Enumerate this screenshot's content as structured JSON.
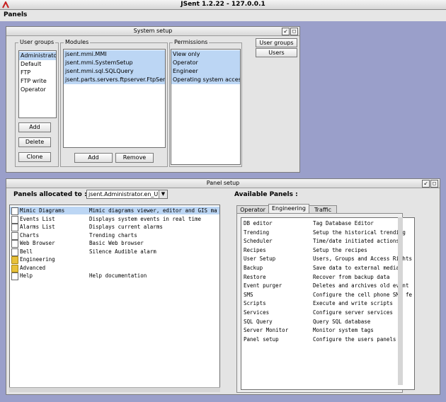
{
  "app_title": "JSent 1.2.22 - 127.0.0.1",
  "menu": {
    "panels": "Panels"
  },
  "system_setup": {
    "title": "System setup",
    "user_groups_label": "User groups",
    "user_groups": [
      "Administrator",
      "Default",
      "FTP",
      "FTP write",
      "Operator"
    ],
    "modules_label": "Modules",
    "modules": [
      "jsent.mmi.MMI",
      "jsent.mmi.SystemSetup",
      "jsent.mmi.sql.SQLQuery",
      "jsent.parts.servers.ftpserver.FtpServer"
    ],
    "permissions_label": "Permissions",
    "permissions": [
      "View only",
      "Operator",
      "Engineer",
      "Operating system access"
    ],
    "btn_add": "Add",
    "btn_delete": "Delete",
    "btn_clone": "Clone",
    "btn_module_add": "Add",
    "btn_remove": "Remove",
    "side_user_groups": "User groups",
    "side_users": "Users"
  },
  "panel_setup": {
    "title": "Panel setup",
    "allocated_label": "Panels allocated to :",
    "allocated_select": "jsent.Administrator.en_UK",
    "available_label": "Available Panels :",
    "allocated": [
      {
        "name": "Mimic Diagrams",
        "desc": "Mimic diagrams viewer, editor and GIS ma",
        "icon": "page-icon"
      },
      {
        "name": "Events List",
        "desc": "Displays system events in real time",
        "icon": "page-icon"
      },
      {
        "name": "Alarms List",
        "desc": "Displays current alarms",
        "icon": "page-icon"
      },
      {
        "name": "Charts",
        "desc": "Trending charts",
        "icon": "page-icon"
      },
      {
        "name": "Web Browser",
        "desc": "Basic Web browser",
        "icon": "page-icon"
      },
      {
        "name": "Bell",
        "desc": "Silence Audible alarm",
        "icon": "page-icon"
      },
      {
        "name": "Engineering",
        "desc": "",
        "icon": "folder-icon"
      },
      {
        "name": "Advanced",
        "desc": "",
        "icon": "folder-icon"
      },
      {
        "name": "Help",
        "desc": "Help documentation",
        "icon": "page-icon"
      }
    ],
    "tabs": [
      "Operator",
      "Engineering",
      "Traffic"
    ],
    "available": [
      {
        "name": "DB editor",
        "desc": "Tag Database Editor"
      },
      {
        "name": "Trending",
        "desc": "Setup the historical trending"
      },
      {
        "name": "Scheduler",
        "desc": "Time/date initiated actions"
      },
      {
        "name": "Recipes",
        "desc": "Setup the recipes"
      },
      {
        "name": "User Setup",
        "desc": "Users, Groups and Access Rights"
      },
      {
        "name": "Backup",
        "desc": "Save data to external media"
      },
      {
        "name": "Restore",
        "desc": "Recover from backup data"
      },
      {
        "name": "Event purger",
        "desc": "Deletes and archives old event"
      },
      {
        "name": "SMS",
        "desc": "Configure the cell phone SMS fe"
      },
      {
        "name": "Scripts",
        "desc": "Execute and write scripts"
      },
      {
        "name": "Services",
        "desc": "Configure server services"
      },
      {
        "name": "SQL Query",
        "desc": "Query SQL database"
      },
      {
        "name": "Server Monitor",
        "desc": "Monitor system tags"
      },
      {
        "name": "Panel setup",
        "desc": "Configure the users panels"
      }
    ]
  }
}
